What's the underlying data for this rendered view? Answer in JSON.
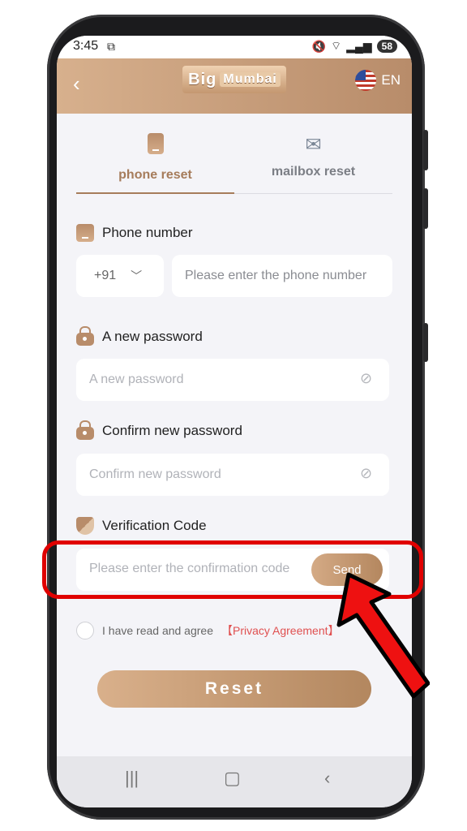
{
  "status": {
    "time": "3:45",
    "battery": "58"
  },
  "header": {
    "logo_left": "Big",
    "logo_right": "Mumbai",
    "lang": "EN"
  },
  "tabs": [
    {
      "label": "phone reset",
      "icon": "phone-icon"
    },
    {
      "label": "mailbox reset",
      "icon": "mail-icon"
    }
  ],
  "phone": {
    "label": "Phone number",
    "country_code": "+91",
    "placeholder": "Please enter the phone number"
  },
  "new_password": {
    "label": "A new password",
    "placeholder": "A new password"
  },
  "confirm_password": {
    "label": "Confirm new password",
    "placeholder": "Confirm new password"
  },
  "verification": {
    "label": "Verification Code",
    "placeholder": "Please enter the confirmation code",
    "send_label": "Send"
  },
  "agreement": {
    "text": "I have read and agree",
    "link": "【Privacy Agreement】"
  },
  "reset_label": "Reset",
  "colors": {
    "accent": "#b88c6a",
    "highlight": "#e00000",
    "background": "#f4f4f8"
  }
}
